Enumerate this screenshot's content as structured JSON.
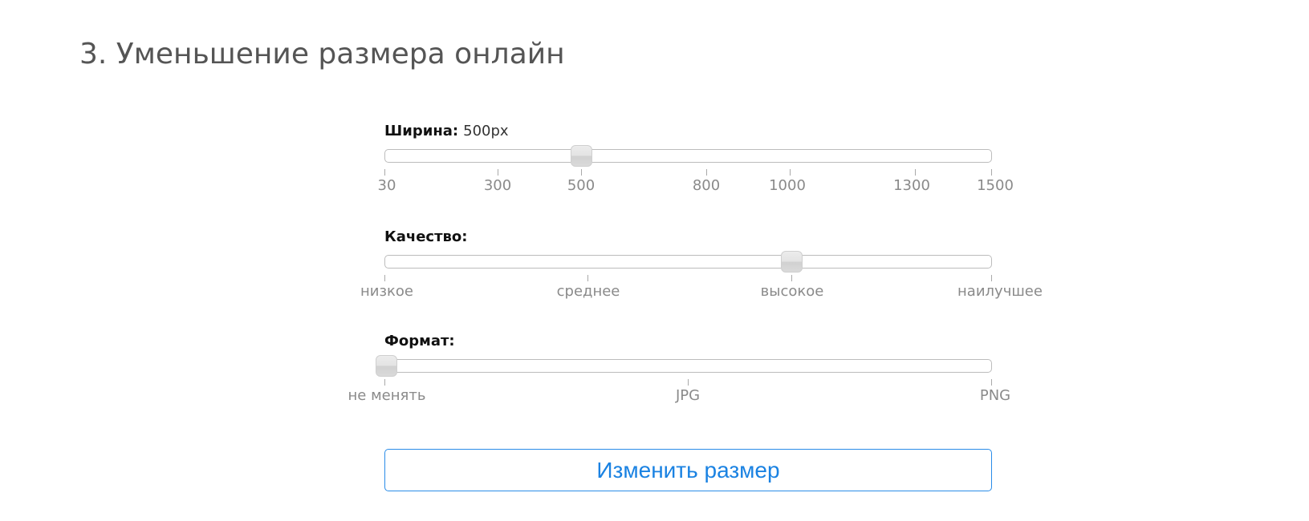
{
  "section": {
    "title": "3. Уменьшение размера онлайн"
  },
  "width_slider": {
    "label": "Ширина:",
    "value_text": "500px",
    "value": 500,
    "ticks": [
      "30",
      "300",
      "500",
      "800",
      "1000",
      "1300",
      "1500"
    ]
  },
  "quality_slider": {
    "label": "Качество:",
    "selected": "высокое",
    "ticks": [
      "низкое",
      "среднее",
      "высокое",
      "наилучшее"
    ]
  },
  "format_slider": {
    "label": "Формат:",
    "selected": "не менять",
    "ticks": [
      "не менять",
      "JPG",
      "PNG"
    ]
  },
  "submit": {
    "label": "Изменить размер"
  },
  "colors": {
    "accent": "#1a82e2",
    "title": "#555555",
    "tick_label": "#8a8a8a",
    "track_border": "#bcbcbc"
  }
}
